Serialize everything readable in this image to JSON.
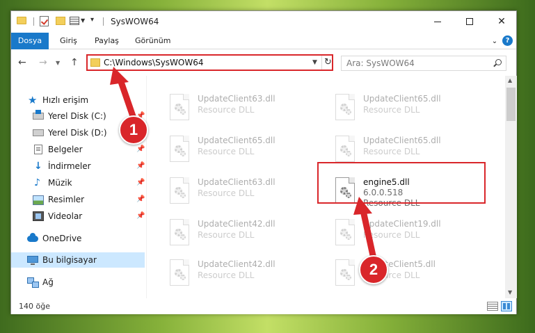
{
  "window": {
    "title": "SysWOW64",
    "controls": {
      "minimize": "minimize",
      "maximize": "maximize",
      "close": "✕"
    }
  },
  "ribbon": {
    "tabs": [
      "Dosya",
      "Giriş",
      "Paylaş",
      "Görünüm"
    ],
    "help": "?"
  },
  "address": {
    "path": "C:\\Windows\\SysWOW64",
    "search_placeholder": "Ara: SysWOW64"
  },
  "sidebar": {
    "items": [
      {
        "label": "Hızlı erişim",
        "icon": "star-icon",
        "pinned": false
      },
      {
        "label": "Yerel Disk (C:)",
        "icon": "windows-drive-icon",
        "pinned": true
      },
      {
        "label": "Yerel Disk (D:)",
        "icon": "drive-icon",
        "pinned": true
      },
      {
        "label": "Belgeler",
        "icon": "documents-icon",
        "pinned": true
      },
      {
        "label": "İndirmeler",
        "icon": "download-icon",
        "pinned": true
      },
      {
        "label": "Müzik",
        "icon": "music-icon",
        "pinned": true
      },
      {
        "label": "Resimler",
        "icon": "pictures-icon",
        "pinned": true
      },
      {
        "label": "Videolar",
        "icon": "videos-icon",
        "pinned": true
      },
      {
        "label": "OneDrive",
        "icon": "onedrive-icon",
        "pinned": false
      },
      {
        "label": "Bu bilgisayar",
        "icon": "this-pc-icon",
        "pinned": false,
        "selected": true
      },
      {
        "label": "Ağ",
        "icon": "network-icon",
        "pinned": false
      }
    ]
  },
  "files": [
    {
      "name": "UpdateClient63.dll",
      "type": "Resource DLL",
      "faded": true
    },
    {
      "name": "UpdateClient65.dll",
      "type": "Resource DLL",
      "faded": true
    },
    {
      "name": "UpdateClient65.dll",
      "type": "Resource DLL",
      "faded": true
    },
    {
      "name": "UpdateClient65.dll",
      "type": "Resource DLL",
      "faded": true
    },
    {
      "name": "UpdateClient63.dll",
      "type": "Resource DLL",
      "faded": true
    },
    {
      "name": "engine5.dll",
      "version": "6.0.0.518",
      "type": "Resource DLL",
      "faded": false,
      "highlighted": true
    },
    {
      "name": "UpdateClient42.dll",
      "type": "Resource DLL",
      "faded": true
    },
    {
      "name": "UpdateClient19.dll",
      "type": "Resource DLL",
      "faded": true
    },
    {
      "name": "UpdateClient42.dll",
      "type": "Resource DLL",
      "faded": true
    },
    {
      "name": "UpdateClient5.dll",
      "type": "Resource DLL",
      "faded": true
    }
  ],
  "status": {
    "item_count": "140 öğe"
  },
  "annotations": {
    "step1": "1",
    "step2": "2",
    "color": "#d9262a"
  },
  "colors": {
    "accent": "#1979ca",
    "selection": "#cce8ff",
    "highlight": "#d9262a"
  }
}
